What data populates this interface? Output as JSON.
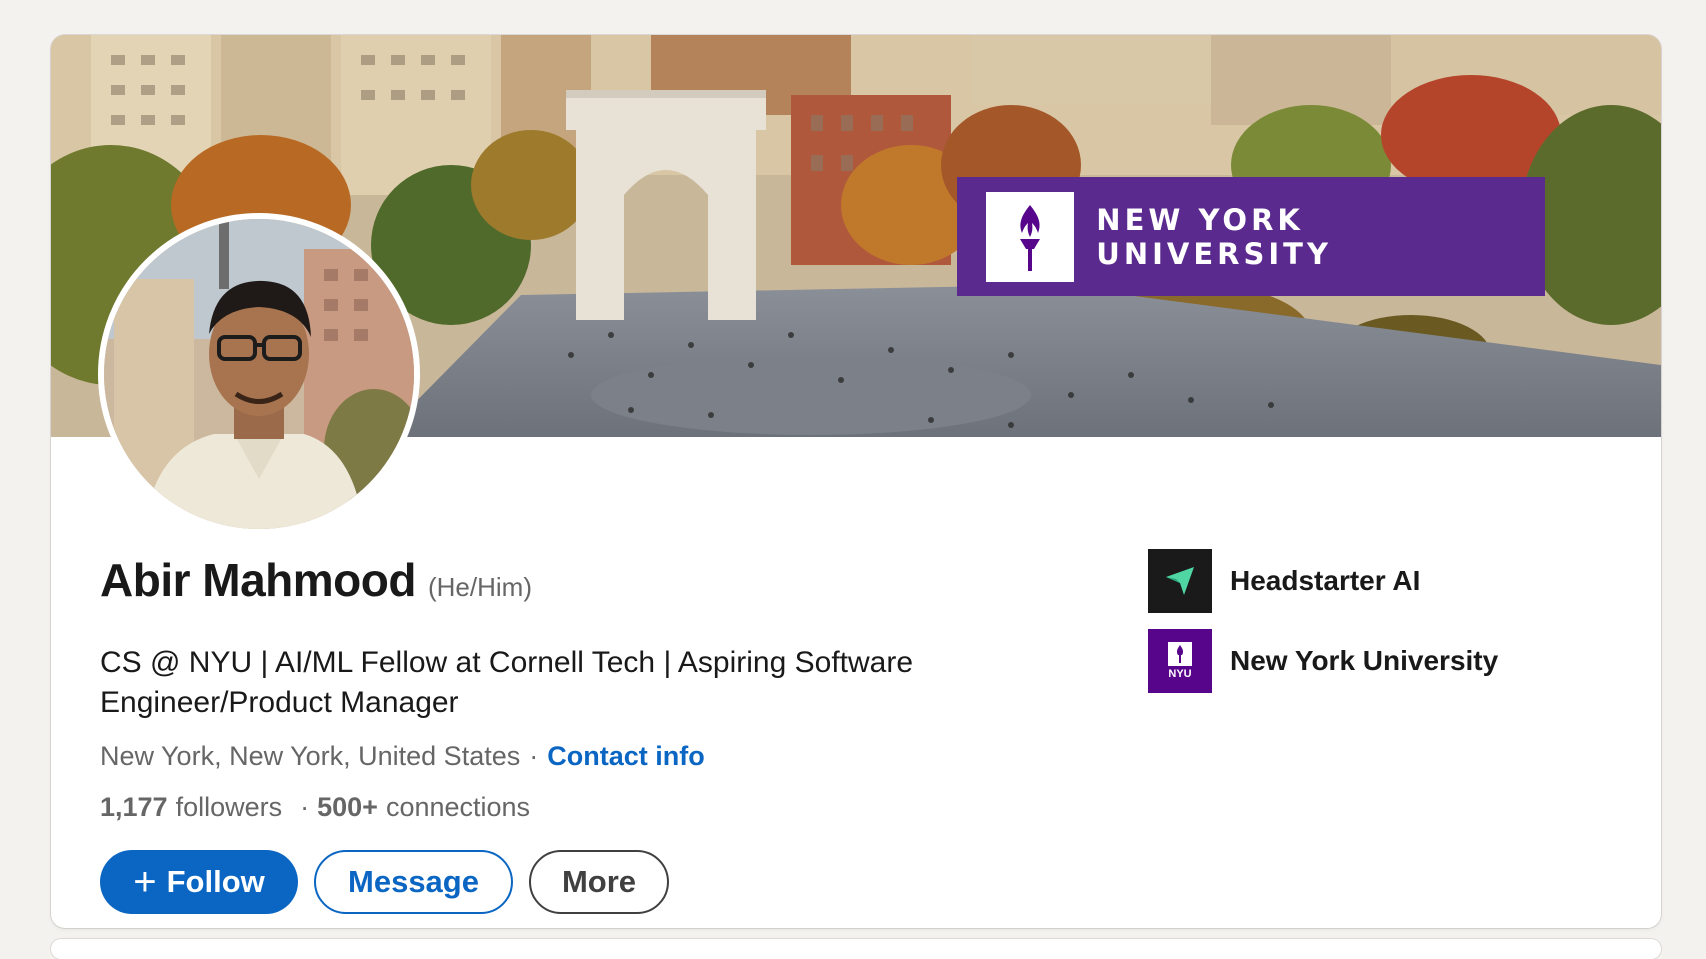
{
  "profile": {
    "name": "Abir Mahmood",
    "pronouns": "(He/Him)",
    "headline": "CS @ NYU | AI/ML Fellow at Cornell Tech | Aspiring Software Engineer/Product Manager",
    "location": "New York, New York, United States",
    "separator": "·",
    "contact_label": "Contact info",
    "followers_count": "1,177",
    "followers_label": "followers",
    "connections_count": "500+",
    "connections_label": "connections"
  },
  "cover": {
    "banner_text": "NEW YORK UNIVERSITY",
    "banner_color": "#5b2a8f"
  },
  "actions": {
    "follow_icon": "+",
    "follow_label": "Follow",
    "message_label": "Message",
    "more_label": "More"
  },
  "organizations": [
    {
      "name": "Headstarter AI",
      "icon": "headstarter-logo-icon"
    },
    {
      "name": "New York University",
      "icon": "nyu-torch-logo-icon",
      "logo_text": "NYU"
    }
  ],
  "colors": {
    "accent": "#0a66c2",
    "nyu_purple": "#57068c",
    "page_bg": "#f4f2ee"
  }
}
